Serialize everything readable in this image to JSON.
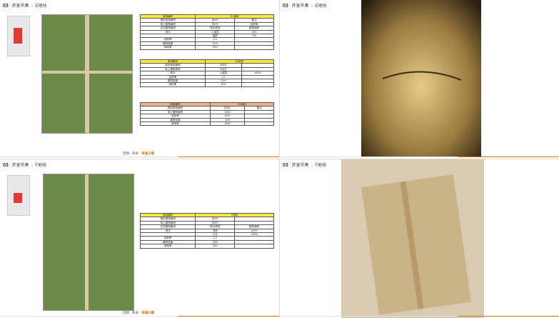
{
  "panels": [
    {
      "header": {
        "num": "03",
        "title": "开发节奏",
        "block": "E地块"
      },
      "footer": {
        "path": "回顾 · 目录",
        "current": "幸福小镇"
      },
      "tables": [
        {
          "head": [
            "用地编号",
            "E1地块",
            ""
          ],
          "rows": [
            [
              "规划用地面积",
              "约8万",
              "备注"
            ],
            [
              "地上建筑面积",
              "约9万",
              "含底商"
            ],
            [
              "住宅建筑面积",
              "物业类型",
              "建筑面积"
            ],
            [
              "其中",
              "小高层",
              "40%"
            ],
            [
              "",
              "高层",
              "5%"
            ],
            [
              "容积率",
              "2.0",
              ""
            ],
            [
              "建筑密度",
              "21%",
              ""
            ],
            [
              "绿地率",
              "30%",
              ""
            ]
          ]
        },
        {
          "head": [
            "用地编号",
            "E2地块",
            ""
          ],
          "rows": [
            [
              "规划用地面积",
              "约8万",
              ""
            ],
            [
              "地上建筑面积",
              "约8万",
              ""
            ],
            [
              "其中",
              "小高层",
              "100%"
            ],
            [
              "容积率",
              "2.0",
              ""
            ],
            [
              "建筑密度",
              "21%",
              ""
            ],
            [
              "绿地率",
              "30%",
              ""
            ]
          ]
        },
        {
          "head": [
            "用地编号",
            "E3地块",
            ""
          ],
          "rows": [
            [
              "规划用地面积",
              "约6万",
              "备注"
            ],
            [
              "地上建筑面积",
              "2000",
              ""
            ],
            [
              "容积率",
              "52%",
              ""
            ],
            [
              "建筑密度",
              "18%",
              ""
            ],
            [
              "绿地率",
              "50%",
              ""
            ]
          ]
        }
      ]
    },
    {
      "header": {
        "num": "03",
        "title": "开发节奏",
        "block": "E地块"
      }
    },
    {
      "header": {
        "num": "03",
        "title": "开发节奏",
        "block": "F地块"
      },
      "footer": {
        "path": "回顾 · 目录",
        "current": "幸福小镇"
      },
      "tables": [
        {
          "head": [
            "用地编号",
            "F地块",
            ""
          ],
          "rows": [
            [
              "规划用地面积",
              "约8万",
              ""
            ],
            [
              "地上建筑面积",
              "约8万",
              ""
            ],
            [
              "住宅建筑面积",
              "物业类型",
              "建筑面积"
            ],
            [
              "其中",
              "洋房",
              "100%"
            ],
            [
              "",
              "小计",
              "100%"
            ],
            [
              "容积率",
              "1.2",
              ""
            ],
            [
              "建筑密度",
              "25%",
              ""
            ],
            [
              "绿地率",
              "30%",
              ""
            ]
          ]
        }
      ]
    },
    {
      "header": {
        "num": "03",
        "title": "开发节奏",
        "block": "F地块"
      }
    }
  ]
}
